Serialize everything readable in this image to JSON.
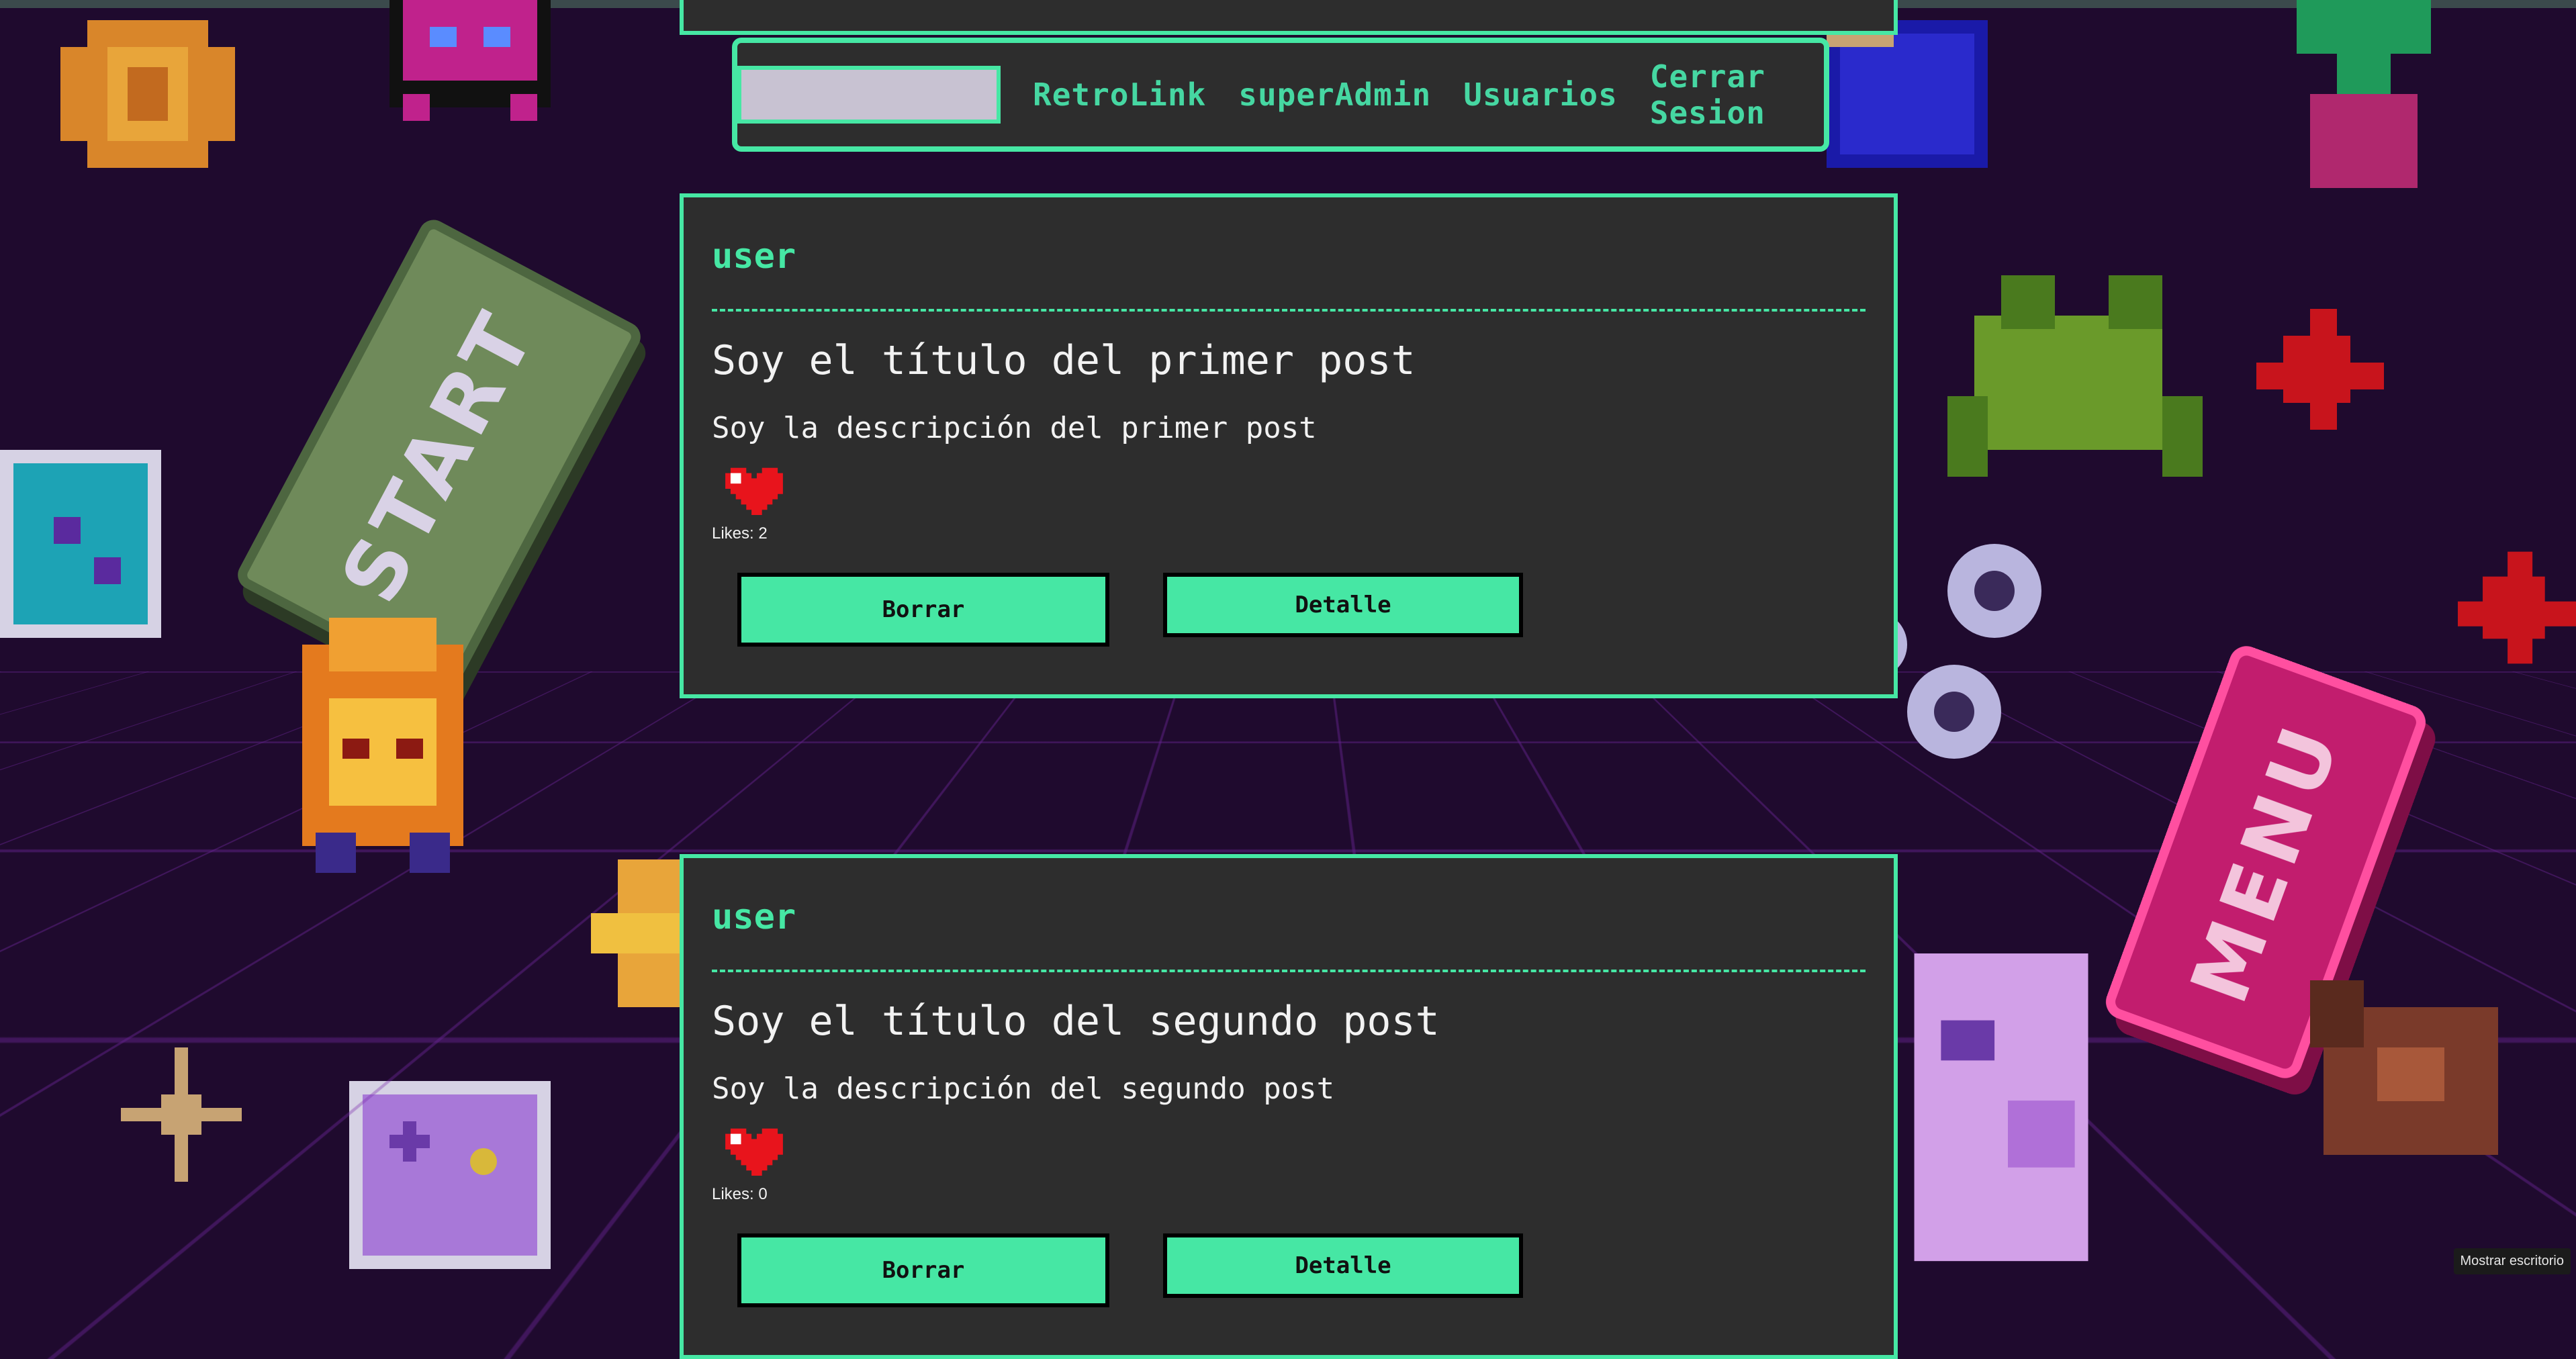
{
  "navbar": {
    "search_placeholder": "",
    "links": [
      "RetroLink",
      "superAdmin",
      "Usuarios",
      "Cerrar Sesion"
    ]
  },
  "posts": [
    {
      "user": "user",
      "title": "Soy el título del primer post",
      "description": "Soy la descripción del primer post",
      "likes_label": "Likes: 2",
      "delete_label": "Borrar",
      "detail_label": "Detalle"
    },
    {
      "user": "user",
      "title": "Soy el título del segundo post",
      "description": "Soy la descripción del segundo post",
      "likes_label": "Likes: 0",
      "delete_label": "Borrar",
      "detail_label": "Detalle"
    }
  ],
  "background": {
    "start_sign": "START",
    "menu_sign": "MENU"
  },
  "tooltip": "Mostrar escritorio",
  "colors": {
    "accent": "#46e7a4",
    "card": "#2d2d2d",
    "background": "#1f0a2e",
    "heart": "#e8141c"
  },
  "icons": [
    "heart-icon"
  ]
}
